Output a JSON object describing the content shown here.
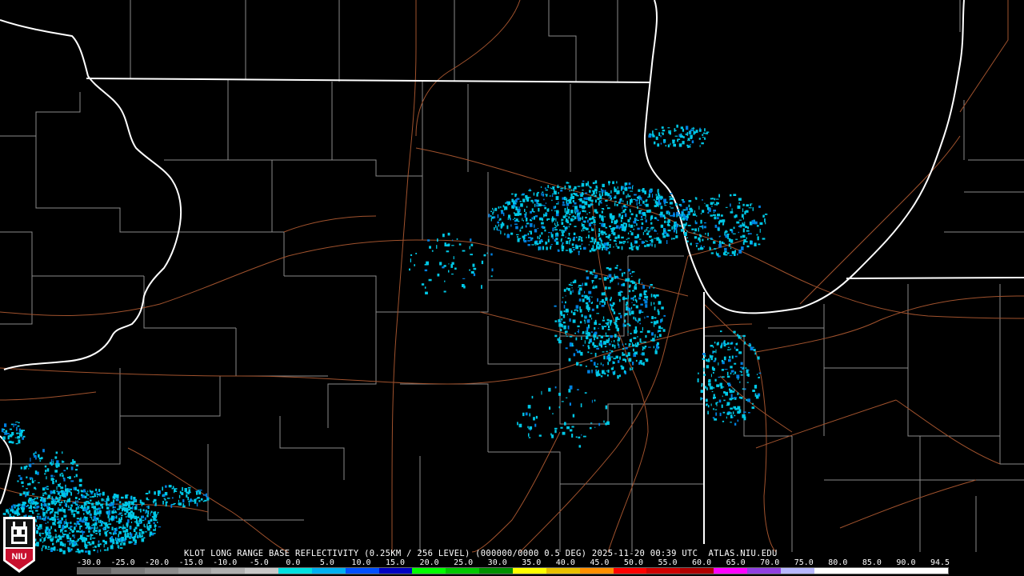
{
  "product": {
    "caption": "KLOT LONG RANGE BASE REFLECTIVITY (0.25KM / 256 LEVEL) (000000/0000 0.5 DEG) 2025-11-20 00:39 UTC  ATLAS.NIU.EDU",
    "logo_text": "NIU"
  },
  "legend": {
    "ticks": [
      "-30.0",
      "-25.0",
      "-20.0",
      "-15.0",
      "-10.0",
      "-5.0",
      "0.0",
      "5.0",
      "10.0",
      "15.0",
      "20.0",
      "25.0",
      "30.0",
      "35.0",
      "40.0",
      "45.0",
      "50.0",
      "55.0",
      "60.0",
      "65.0",
      "70.0",
      "75.0",
      "80.0",
      "85.0",
      "90.0",
      "94.5"
    ],
    "colors": [
      "#606060",
      "#7a7a7a",
      "#8c8c8c",
      "#9e9e9e",
      "#b0b0b0",
      "#c8c8c8",
      "#00e0e0",
      "#00b0f0",
      "#0050ff",
      "#0000c0",
      "#00ff00",
      "#00c800",
      "#009000",
      "#ffff00",
      "#e8c000",
      "#ff9000",
      "#ff0000",
      "#d00000",
      "#b00000",
      "#ff00ff",
      "#9040e0",
      "#b8b8ff",
      "#ffffff",
      "#ffffff",
      "#ffffff",
      "#ffffff"
    ]
  },
  "colors": {
    "state_lines": "#ffffff",
    "county_lines": "#8a8a8a",
    "roads": "#a0522d",
    "echo_light": "#00c8e6",
    "echo_medium": "#0080e0"
  }
}
